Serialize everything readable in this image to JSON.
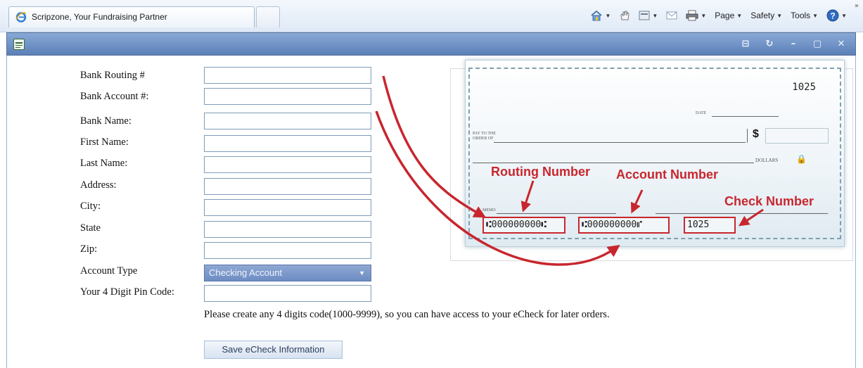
{
  "browser": {
    "tab_title": "Scripzone, Your Fundraising Partner",
    "commands": {
      "page": "Page",
      "safety": "Safety",
      "tools": "Tools"
    }
  },
  "form": {
    "fields": [
      {
        "label": "Bank Routing #",
        "value": ""
      },
      {
        "label": "Bank Account #:",
        "value": ""
      },
      {
        "label": "Bank Name:",
        "value": ""
      },
      {
        "label": "First Name:",
        "value": ""
      },
      {
        "label": "Last Name:",
        "value": ""
      },
      {
        "label": "Address:",
        "value": ""
      },
      {
        "label": "City:",
        "value": ""
      },
      {
        "label": "State",
        "value": ""
      },
      {
        "label": "Zip:",
        "value": ""
      }
    ],
    "account_type_label": "Account Type",
    "account_type_value": "Checking Account",
    "pin_label": "Your 4 Digit Pin Code:",
    "pin_value": "",
    "help_text": "Please create any 4 digits code(1000-9999), so you can have access to your eCheck for later orders.",
    "save_label": "Save eCheck Information"
  },
  "check": {
    "number": "1025",
    "date_label": "DATE",
    "pay_to_label_1": "PAY TO THE",
    "pay_to_label_2": "ORDER OF",
    "dollar_sign": "$",
    "dollars_label": "DOLLARS",
    "memo_label": "MEMO",
    "annotations": {
      "routing": "Routing Number",
      "account": "Account Number",
      "check": "Check Number"
    },
    "micr_routing": "⑆000000000⑆",
    "micr_account": "⑆000000000⑈",
    "micr_check": "1025"
  },
  "colors": {
    "annotation_red": "#c8262e",
    "titlebar_blue": "#6a8dc4"
  }
}
